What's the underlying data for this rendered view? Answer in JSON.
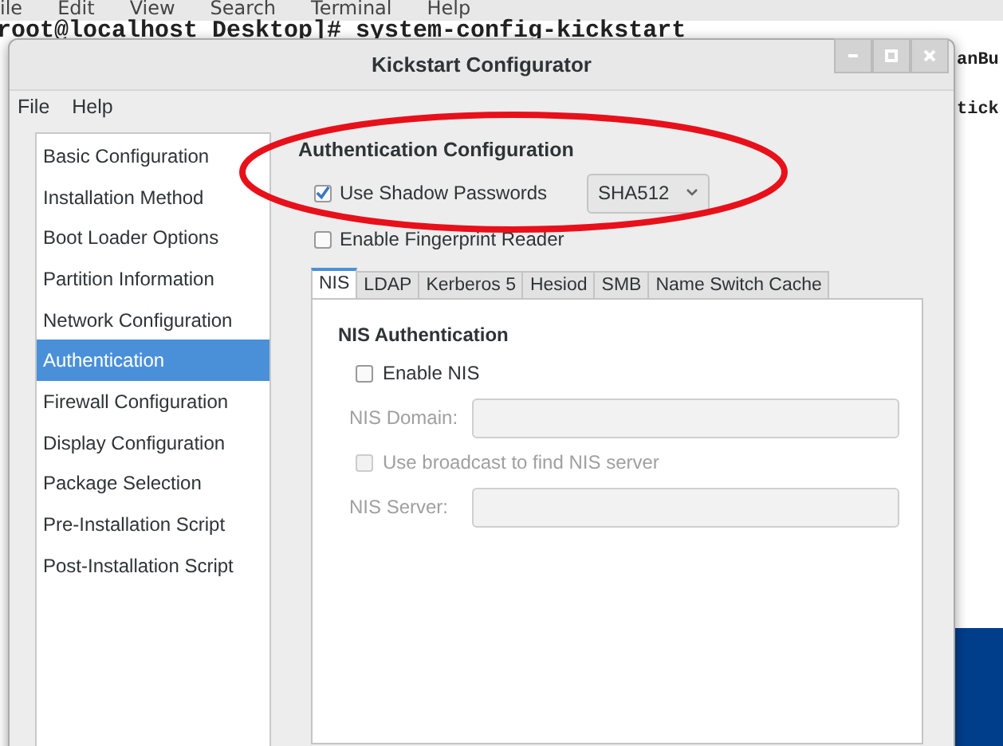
{
  "terminal": {
    "menu": [
      "ile",
      "Edit",
      "View",
      "Search",
      "Terminal",
      "Help"
    ],
    "command": "root@localhost Desktop]# system-config-kickstart",
    "right_fragments": [
      "anBu",
      "tick"
    ]
  },
  "window": {
    "title": "Kickstart Configurator",
    "menu": [
      "File",
      "Help"
    ],
    "sidebar": {
      "items": [
        {
          "label": "Basic Configuration",
          "selected": false
        },
        {
          "label": "Installation Method",
          "selected": false
        },
        {
          "label": "Boot Loader Options",
          "selected": false
        },
        {
          "label": "Partition Information",
          "selected": false
        },
        {
          "label": "Network Configuration",
          "selected": false
        },
        {
          "label": "Authentication",
          "selected": true
        },
        {
          "label": "Firewall Configuration",
          "selected": false
        },
        {
          "label": "Display Configuration",
          "selected": false
        },
        {
          "label": "Package Selection",
          "selected": false
        },
        {
          "label": "Pre-Installation Script",
          "selected": false
        },
        {
          "label": "Post-Installation Script",
          "selected": false
        }
      ]
    },
    "section_title": "Authentication Configuration",
    "shadow_passwords": {
      "label": "Use Shadow Passwords",
      "checked": true,
      "algorithm": "SHA512"
    },
    "fingerprint": {
      "label": "Enable Fingerprint Reader",
      "checked": false
    },
    "tabs": [
      {
        "label": "NIS",
        "selected": true
      },
      {
        "label": "LDAP",
        "selected": false
      },
      {
        "label": "Kerberos 5",
        "selected": false
      },
      {
        "label": "Hesiod",
        "selected": false
      },
      {
        "label": "SMB",
        "selected": false
      },
      {
        "label": "Name Switch Cache",
        "selected": false
      }
    ],
    "panel": {
      "title": "NIS Authentication",
      "rows": [
        {
          "kind": "checkbox",
          "label": "Enable NIS",
          "checked": false,
          "disabled": false
        },
        {
          "kind": "field",
          "label": "NIS Domain:",
          "disabled": true
        },
        {
          "kind": "checkbox",
          "label": "Use broadcast to find NIS server",
          "checked": false,
          "disabled": true
        },
        {
          "kind": "field",
          "label": "NIS Server:",
          "disabled": true
        }
      ]
    }
  },
  "annotation": {
    "kind": "ellipse"
  }
}
